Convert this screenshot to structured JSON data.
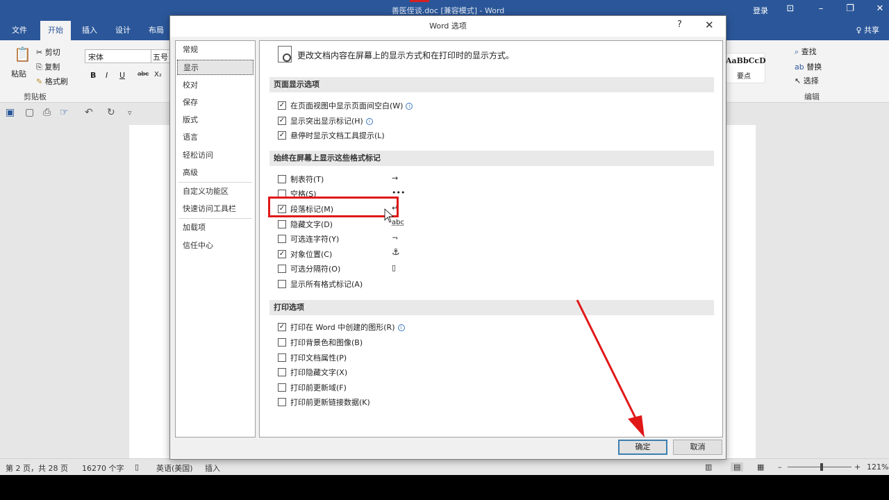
{
  "window": {
    "title": "善医侄谈.doc [兼容模式]  -  Word",
    "login": "登录",
    "controls": {
      "ribbon_opts": "⊡",
      "minimize": "–",
      "restore": "❐",
      "close": "✕"
    }
  },
  "tabs": [
    "文件",
    "开始",
    "插入",
    "设计",
    "布局"
  ],
  "share": "♀ 共享",
  "ribbon": {
    "paste": "粘贴",
    "cut": "剪切",
    "copy": "复制",
    "format_painter": "格式刷",
    "clipboard_group": "剪贴板",
    "font_name": "宋体",
    "font_size": "五号",
    "bold": "B",
    "italic": "I",
    "underline": "U",
    "strike": "abc",
    "sub": "X₂",
    "style_preview": "AaBbCcD",
    "style_name": "要点",
    "find": "查找",
    "replace": "替换",
    "select": "选择",
    "edit_group": "编辑"
  },
  "status": {
    "page": "第 2 页，共 28 页",
    "words": "16270 个字",
    "lang": "英语(美国)",
    "mode": "插入",
    "zoom": "121%"
  },
  "dialog": {
    "title": "Word 选项",
    "help": "?",
    "close": "✕",
    "nav": [
      "常规",
      "显示",
      "校对",
      "保存",
      "版式",
      "语言",
      "轻松访问",
      "高级",
      "自定义功能区",
      "快速访问工具栏",
      "加载项",
      "信任中心"
    ],
    "selected_nav": "显示",
    "intro": "更改文档内容在屏幕上的显示方式和在打印时的显示方式。",
    "sections": {
      "page_display": {
        "title": "页面显示选项",
        "options": [
          {
            "label": "在页面视图中显示页面间空白(W)",
            "checked": true,
            "info": true
          },
          {
            "label": "显示突出显示标记(H)",
            "checked": true,
            "info": true
          },
          {
            "label": "悬停时显示文档工具提示(L)",
            "checked": true,
            "info": false
          }
        ]
      },
      "format_marks": {
        "title": "始终在屏幕上显示这些格式标记",
        "options": [
          {
            "label": "制表符(T)",
            "checked": false,
            "symbol": "→"
          },
          {
            "label": "空格(S)",
            "checked": false,
            "symbol": "•••"
          },
          {
            "label": "段落标记(M)",
            "checked": true,
            "symbol": "↵"
          },
          {
            "label": "隐藏文字(D)",
            "checked": false,
            "symbol": "abc"
          },
          {
            "label": "可选连字符(Y)",
            "checked": false,
            "symbol": "¬"
          },
          {
            "label": "对象位置(C)",
            "checked": true,
            "symbol": "⚓"
          },
          {
            "label": "可选分隔符(O)",
            "checked": false,
            "symbol": "▯"
          },
          {
            "label": "显示所有格式标记(A)",
            "checked": false,
            "symbol": ""
          }
        ]
      },
      "print": {
        "title": "打印选项",
        "options": [
          {
            "label": "打印在 Word 中创建的图形(R)",
            "checked": true,
            "info": true
          },
          {
            "label": "打印背景色和图像(B)",
            "checked": false,
            "info": false
          },
          {
            "label": "打印文档属性(P)",
            "checked": false,
            "info": false
          },
          {
            "label": "打印隐藏文字(X)",
            "checked": false,
            "info": false
          },
          {
            "label": "打印前更新域(F)",
            "checked": false,
            "info": false
          },
          {
            "label": "打印前更新链接数据(K)",
            "checked": false,
            "info": false
          }
        ]
      }
    },
    "ok": "确定",
    "cancel": "取消"
  },
  "colors": {
    "title_bar": "#2b579a",
    "highlight": "#e01818",
    "arrow": "#e01818"
  }
}
